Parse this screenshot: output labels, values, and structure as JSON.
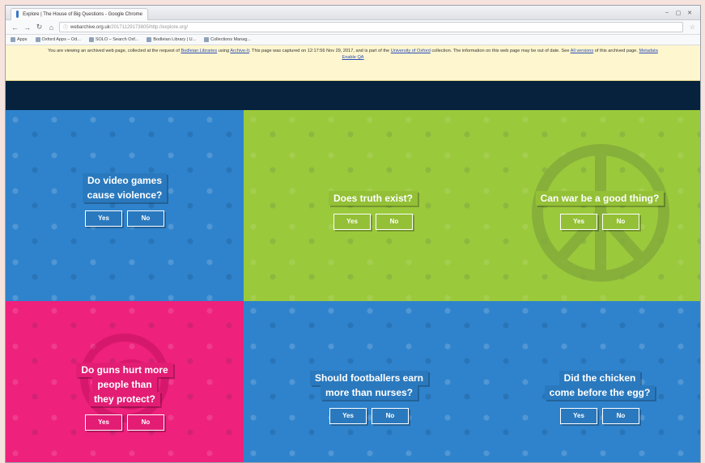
{
  "browser": {
    "tab_title": "Explore | The House of Big Questions - Google Chrome",
    "url": "webarchive.org.uk",
    "url_tail": "/20171129173805/http://explore.org/",
    "win_min": "–",
    "win_max": "▢",
    "win_close": "✕",
    "bookmarks": [
      "Apps",
      "Oxford Apps – Od...",
      "SOLO – Search Oxf...",
      "Bodleian Library | U...",
      "Collections Manag..."
    ]
  },
  "archive_banner": {
    "text_before_link1": "You are viewing an archived web page, collected at the request of ",
    "link1": "Bodleian Libraries",
    "text_after_link1": " using ",
    "link2": "Archive-It",
    "text_after_link2": ". This page was captured on 12:17:56 Nov 29, 2017, and is part of the ",
    "link3": "University of Oxford",
    "text_after_link3": " collection. The information on this web page may be out of date. See ",
    "link4": "All versions",
    "text_after_link4": " of this archived page. ",
    "link5": "Metadata",
    "link6": "Enable QA"
  },
  "questions": [
    {
      "line1": "Do video games",
      "line2": "cause violence?",
      "line3": "",
      "yes": "Yes",
      "no": "No"
    },
    {
      "line1": "Does truth exist?",
      "line2": "",
      "line3": "",
      "yes": "Yes",
      "no": "No"
    },
    {
      "line1": "Can war be a good thing?",
      "line2": "",
      "line3": "",
      "yes": "Yes",
      "no": "No"
    },
    {
      "line1": "Do guns hurt more",
      "line2": "people than",
      "line3": "they protect?",
      "yes": "Yes",
      "no": "No"
    },
    {
      "line1": "Should footballers earn",
      "line2": "more than nurses?",
      "line3": "",
      "yes": "Yes",
      "no": "No"
    },
    {
      "line1": "Did the chicken",
      "line2": "come before the egg?",
      "line3": "",
      "yes": "Yes",
      "no": "No"
    }
  ],
  "colors": {
    "blue": "#2f83cc",
    "green": "#9bc93c",
    "pink": "#ee217c",
    "header": "#07223d"
  }
}
